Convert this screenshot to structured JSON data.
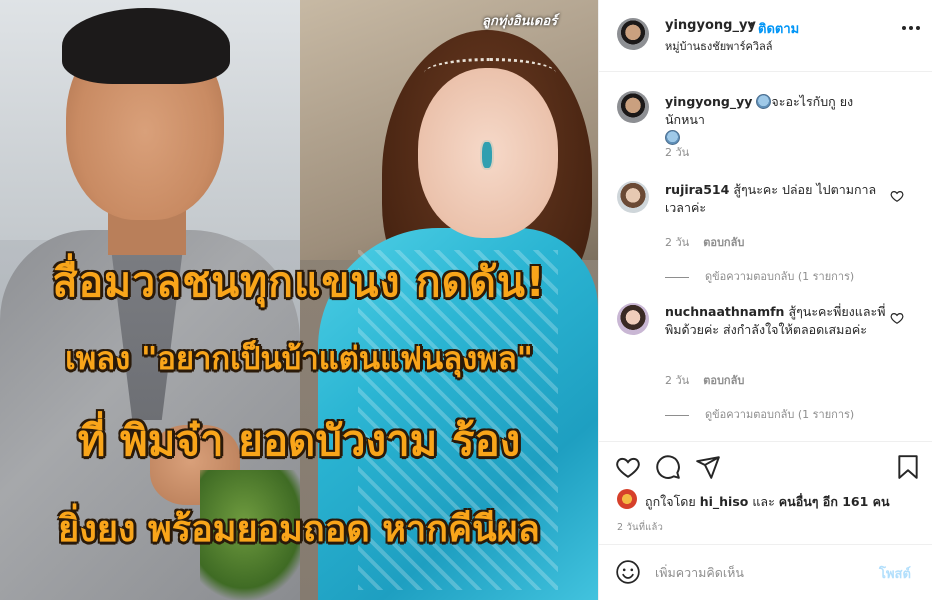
{
  "post_image": {
    "watermark": "ลูกทุ่งอินเดอร์",
    "headline_lines": [
      "สื่อมวลชนทุกแขนง กดดัน!",
      "เพลง \"อยากเป็นบ้าแต่นแฟนลุงพล\"",
      "ที่ พิมจ๋า ยอดบัวงาม ร้อง",
      "ยิ่งยง พร้อมยอมถอด หากคีนีผล"
    ],
    "headline_color": "#f9a51a"
  },
  "header": {
    "username": "yingyong_yy",
    "separator": "•",
    "follow_label": "ติดตาม",
    "location": "หมู่บ้านธงชัยพาร์ควิลล์"
  },
  "caption": {
    "username": "yingyong_yy",
    "text": "จะอะไรกับกู ยงนักหนา",
    "time": "2 วัน"
  },
  "comments": [
    {
      "username": "rujira514",
      "text": "สู้ๆนะคะ ปล่อย ไปตามกาลเวลาค่ะ",
      "time": "2 วัน",
      "reply_label": "ตอบกลับ",
      "view_replies": "ดูข้อความตอบกลับ (1 รายการ)"
    },
    {
      "username": "nuchnaathnamfn",
      "text": "สู้ๆนะคะพี่ยงและพี่พิมด้วยค่ะ ส่งกำลังใจให้ตลอดเสมอค่ะ",
      "time": "2 วัน",
      "reply_label": "ตอบกลับ",
      "view_replies": "ดูข้อความตอบกลับ (1 รายการ)"
    }
  ],
  "actions": {
    "liked_prefix": "ถูกใจโดย",
    "liked_user": "hi_hiso",
    "liked_and": "และ",
    "liked_others": "คนอื่นๆ อีก 161 คน",
    "time_ago": "2 วันที่แล้ว"
  },
  "add_comment": {
    "placeholder": "เพิ่มความคิดเห็น",
    "post_label": "โพสต์"
  },
  "colors": {
    "link_blue": "#0095f6",
    "post_disabled": "#b2dffc",
    "muted": "#8e8e8e"
  }
}
